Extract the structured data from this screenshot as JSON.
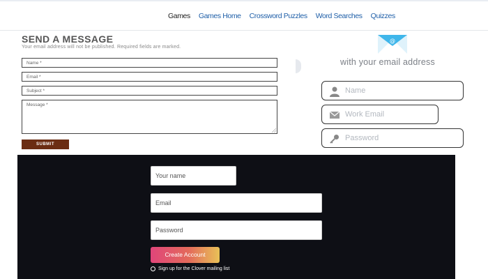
{
  "nav": {
    "items": [
      {
        "label": "Games",
        "active": true
      },
      {
        "label": "Games Home",
        "active": false
      },
      {
        "label": "Crossword Puzzles",
        "active": false
      },
      {
        "label": "Word Searches",
        "active": false
      },
      {
        "label": "Quizzes",
        "active": false
      }
    ]
  },
  "message_form": {
    "title": "SEND A MESSAGE",
    "subtitle": "Your email address will not be published. Required fields are marked.",
    "name_placeholder": "Name *",
    "email_placeholder": "Email *",
    "subject_placeholder": "Subject *",
    "message_placeholder": "Message *",
    "submit_label": "SUBMIT"
  },
  "email_signup": {
    "envelope_symbol": "@",
    "tagline": "with your email address",
    "name_placeholder": "Name",
    "work_email_placeholder": "Work Email",
    "password_placeholder": "Password"
  },
  "account_form": {
    "name_placeholder": "Your name",
    "email_placeholder": "Email",
    "password_placeholder": "Password",
    "create_label": "Create Account",
    "mailing_label": "Sign up for the Clover mailing list"
  },
  "colors": {
    "nav_link": "#1f5fa8",
    "submit_bg": "#6b2d13",
    "dark_panel": "#0e0f15",
    "envelope": "#3fb6ea"
  }
}
